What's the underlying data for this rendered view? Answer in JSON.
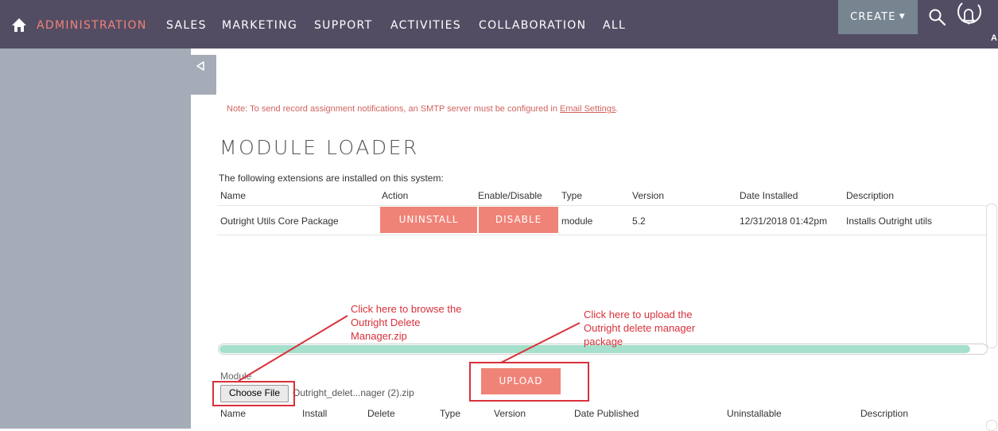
{
  "nav": {
    "items": [
      "ADMINISTRATION",
      "SALES",
      "MARKETING",
      "SUPPORT",
      "ACTIVITIES",
      "COLLABORATION",
      "ALL"
    ],
    "create_label": "CREATE",
    "user_initial": "A",
    "icons": {
      "home": "home-icon",
      "search": "search-icon",
      "bell": "bell-icon",
      "collapse": "collapse-sidebar-icon"
    }
  },
  "note": {
    "text": "Note: To send record assignment notifications, an SMTP server must be configured in ",
    "link": "Email Settings",
    "end": "."
  },
  "page": {
    "title": "MODULE LOADER"
  },
  "installed": {
    "intro": "The following extensions are installed on this system:",
    "headers": [
      "Name",
      "Action",
      "Enable/Disable",
      "Type",
      "Version",
      "Date Installed",
      "Description"
    ],
    "rows": [
      {
        "name": "Outright Utils Core Package",
        "action": "UNINSTALL",
        "toggle": "DISABLE",
        "type": "module",
        "version": "5.2",
        "date": "12/31/2018 01:42pm",
        "description": "Installs Outright utils"
      }
    ]
  },
  "upload": {
    "module_label": "Module",
    "choose_label": "Choose File",
    "file_name": "Outright_delet...nager (2).zip",
    "button": "UPLOAD"
  },
  "annotations": {
    "browse": [
      "Click here to browse the",
      "Outright Delete",
      "Manager.zip"
    ],
    "upload": [
      "Click here to upload the",
      "Outright delete manager",
      "package"
    ]
  },
  "list_headers": [
    "Name",
    "Install",
    "Delete",
    "Type",
    "Version",
    "Date Published",
    "Uninstallable",
    "Description"
  ],
  "colors": {
    "topbar": "#534d64",
    "active_nav": "#f08377",
    "accent_button": "#f08377",
    "create_button": "#778591",
    "sidebar": "#a5acb7",
    "annotation": "#d8313b",
    "progress": "#a4e0cb"
  }
}
